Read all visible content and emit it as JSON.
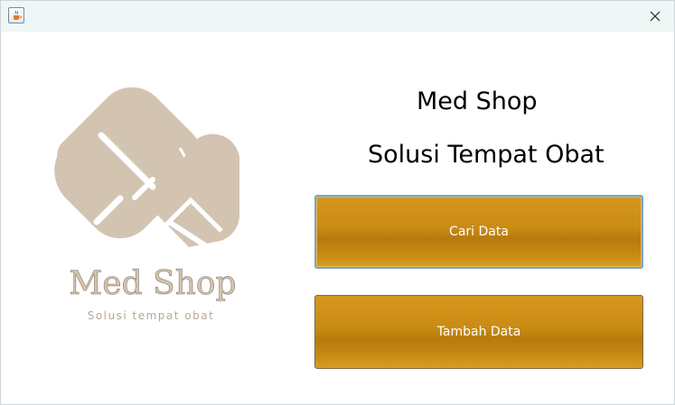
{
  "window": {
    "app_icon": "java-cup-icon",
    "close_icon": "close-icon"
  },
  "logo": {
    "icon": "capsule-pill-icon",
    "brand_name": "Med Shop",
    "tagline": "Solusi tempat obat",
    "color": "#d3c4b1"
  },
  "main": {
    "title": "Med Shop",
    "subtitle": "Solusi Tempat Obat"
  },
  "buttons": {
    "cari_data": "Cari Data",
    "tambah_data": "Tambah Data",
    "color": "#c98b14"
  }
}
